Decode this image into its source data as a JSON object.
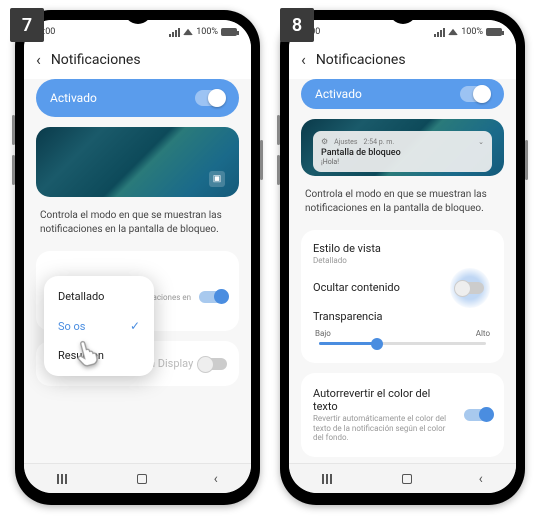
{
  "steps": {
    "s7": "7",
    "s8": "8"
  },
  "status": {
    "time": "9:00",
    "battery": "100%"
  },
  "header": {
    "title": "Notificaciones"
  },
  "pill": {
    "label": "Activado"
  },
  "desc": "Controla el modo en que se muestran las notificaciones en la pantalla de bloqueo.",
  "screen7": {
    "popup": {
      "opt1": "Detallado",
      "opt2": "Solo íconos",
      "opt2_visible": "So         os",
      "opt3": "Resumen"
    },
    "partial_row": "notificaciones en",
    "aod_row": "Mostrar en Always On Display"
  },
  "screen8": {
    "preview": {
      "app": "Ajustes",
      "time": "2:54 p. m.",
      "title": "Pantalla de bloqueo",
      "sub": "¡Hola!"
    },
    "style_label": "Estilo de vista",
    "style_value": "Detallado",
    "hide_label": "Ocultar contenido",
    "transparency_label": "Transparencia",
    "slider": {
      "low": "Bajo",
      "high": "Alto"
    },
    "autorevert_label": "Autorrevertir el color del texto",
    "autorevert_sub": "Revertir automáticamente el color del texto de la notificación según el color del fondo."
  }
}
